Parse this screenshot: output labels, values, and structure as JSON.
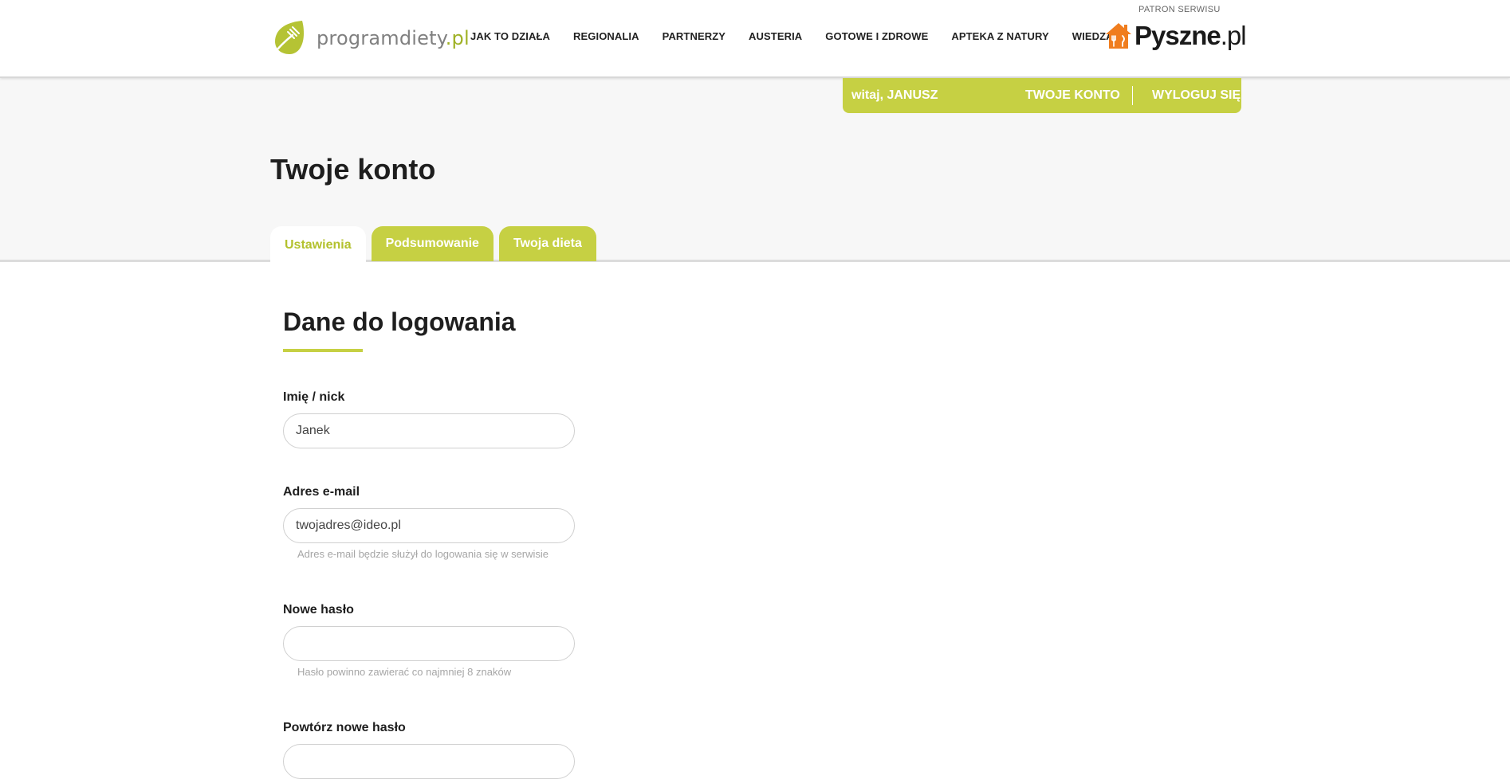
{
  "brand": {
    "name": "programdiety",
    "tld": ".pl"
  },
  "nav": {
    "items": [
      "JAK TO DZIAŁA",
      "REGIONALIA",
      "PARTNERZY",
      "AUSTERIA",
      "GOTOWE I ZDROWE",
      "APTEKA Z NATURY",
      "WIEDZA"
    ]
  },
  "patron": {
    "label": "PATRON SERWISU",
    "name": "Pyszne",
    "tld": ".pl"
  },
  "user_bar": {
    "greeting": "witaj, JANUSZ",
    "account": "TWOJE KONTO",
    "logout": "WYLOGUJ SIĘ"
  },
  "page": {
    "title": "Twoje konto"
  },
  "tabs": [
    {
      "label": "Ustawienia",
      "active": true
    },
    {
      "label": "Podsumowanie",
      "active": false
    },
    {
      "label": "Twoja dieta",
      "active": false
    }
  ],
  "form": {
    "section_title": "Dane do logowania",
    "fields": [
      {
        "label": "Imię / nick",
        "value": "Janek",
        "hint": ""
      },
      {
        "label": "Adres e-mail",
        "value": "twojadres@ideo.pl",
        "hint": "Adres e-mail będzie służył do logowania się w serwisie"
      },
      {
        "label": "Nowe hasło",
        "value": "",
        "hint": "Hasło powinno zawierać co najmniej 8 znaków"
      },
      {
        "label": "Powtórz nowe hasło",
        "value": "",
        "hint": ""
      }
    ]
  },
  "colors": {
    "accent": "#c6d043",
    "accent_text": "#b3c12d",
    "partner_orange": "#f07d1e"
  }
}
